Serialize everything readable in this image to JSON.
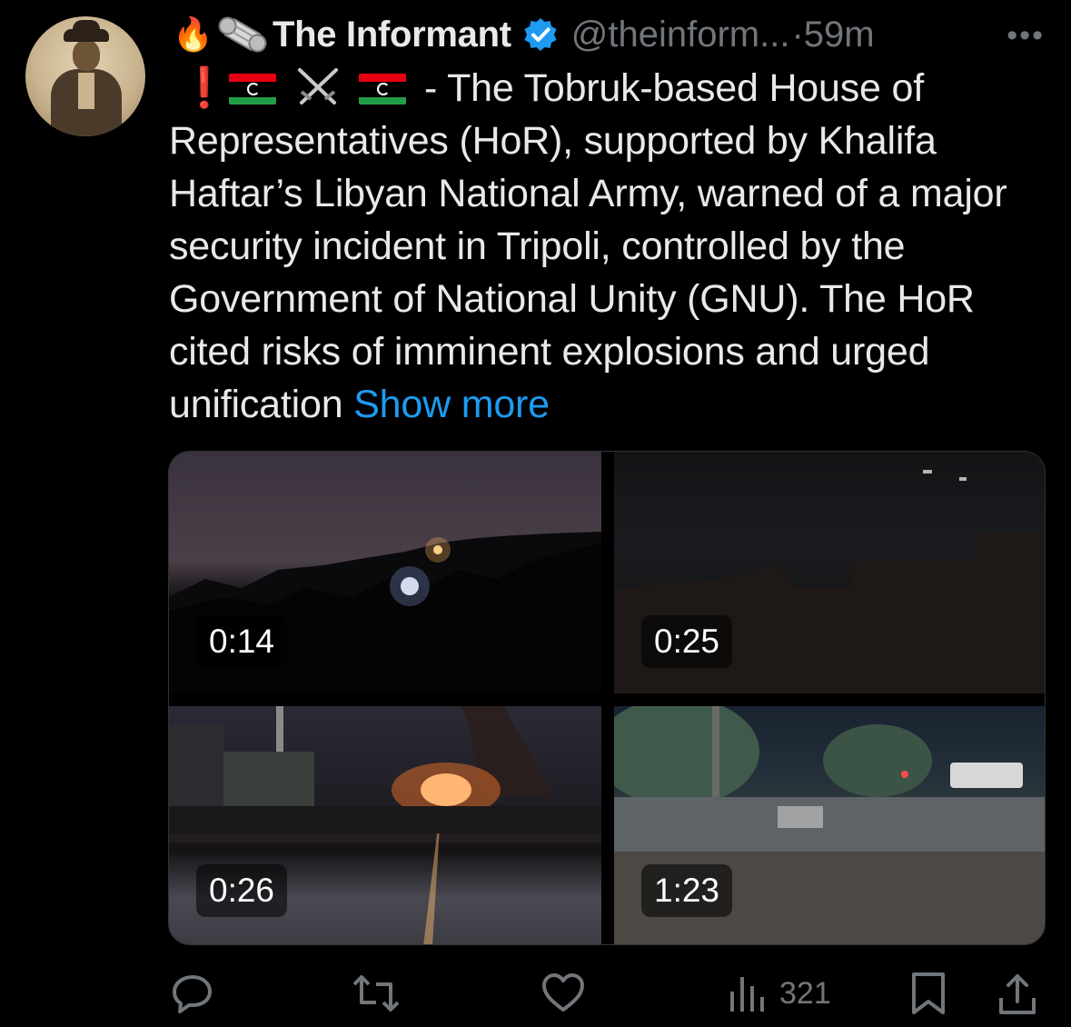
{
  "tweet": {
    "author_name": "The Informant",
    "handle": "@theinform...",
    "separator": "·",
    "time": "59m",
    "more_label": "•••",
    "emoji_lead": "🔥",
    "excl": "❗",
    "text_intro": " - The Tobruk-based House of Representatives (HoR), supported by Khalifa Haftar’s Libyan National Army, warned of a major security incident in Tripoli, controlled by the Government of National Unity (GNU). The HoR cited risks of imminent explosions and urged unification ",
    "show_more": "Show more"
  },
  "media": [
    {
      "duration": "0:14"
    },
    {
      "duration": "0:25"
    },
    {
      "duration": "0:26"
    },
    {
      "duration": "1:23"
    }
  ],
  "actions": {
    "reply_icon": "reply-icon",
    "repost_icon": "repost-icon",
    "like_icon": "like-icon",
    "views_icon": "views-icon",
    "views_count": "321",
    "bookmark_icon": "bookmark-icon",
    "share_icon": "share-icon"
  },
  "colors": {
    "background": "#000000",
    "text": "#e7e9ea",
    "muted": "#71767b",
    "link": "#1d9bf0",
    "verified": "#1d9bf0"
  }
}
